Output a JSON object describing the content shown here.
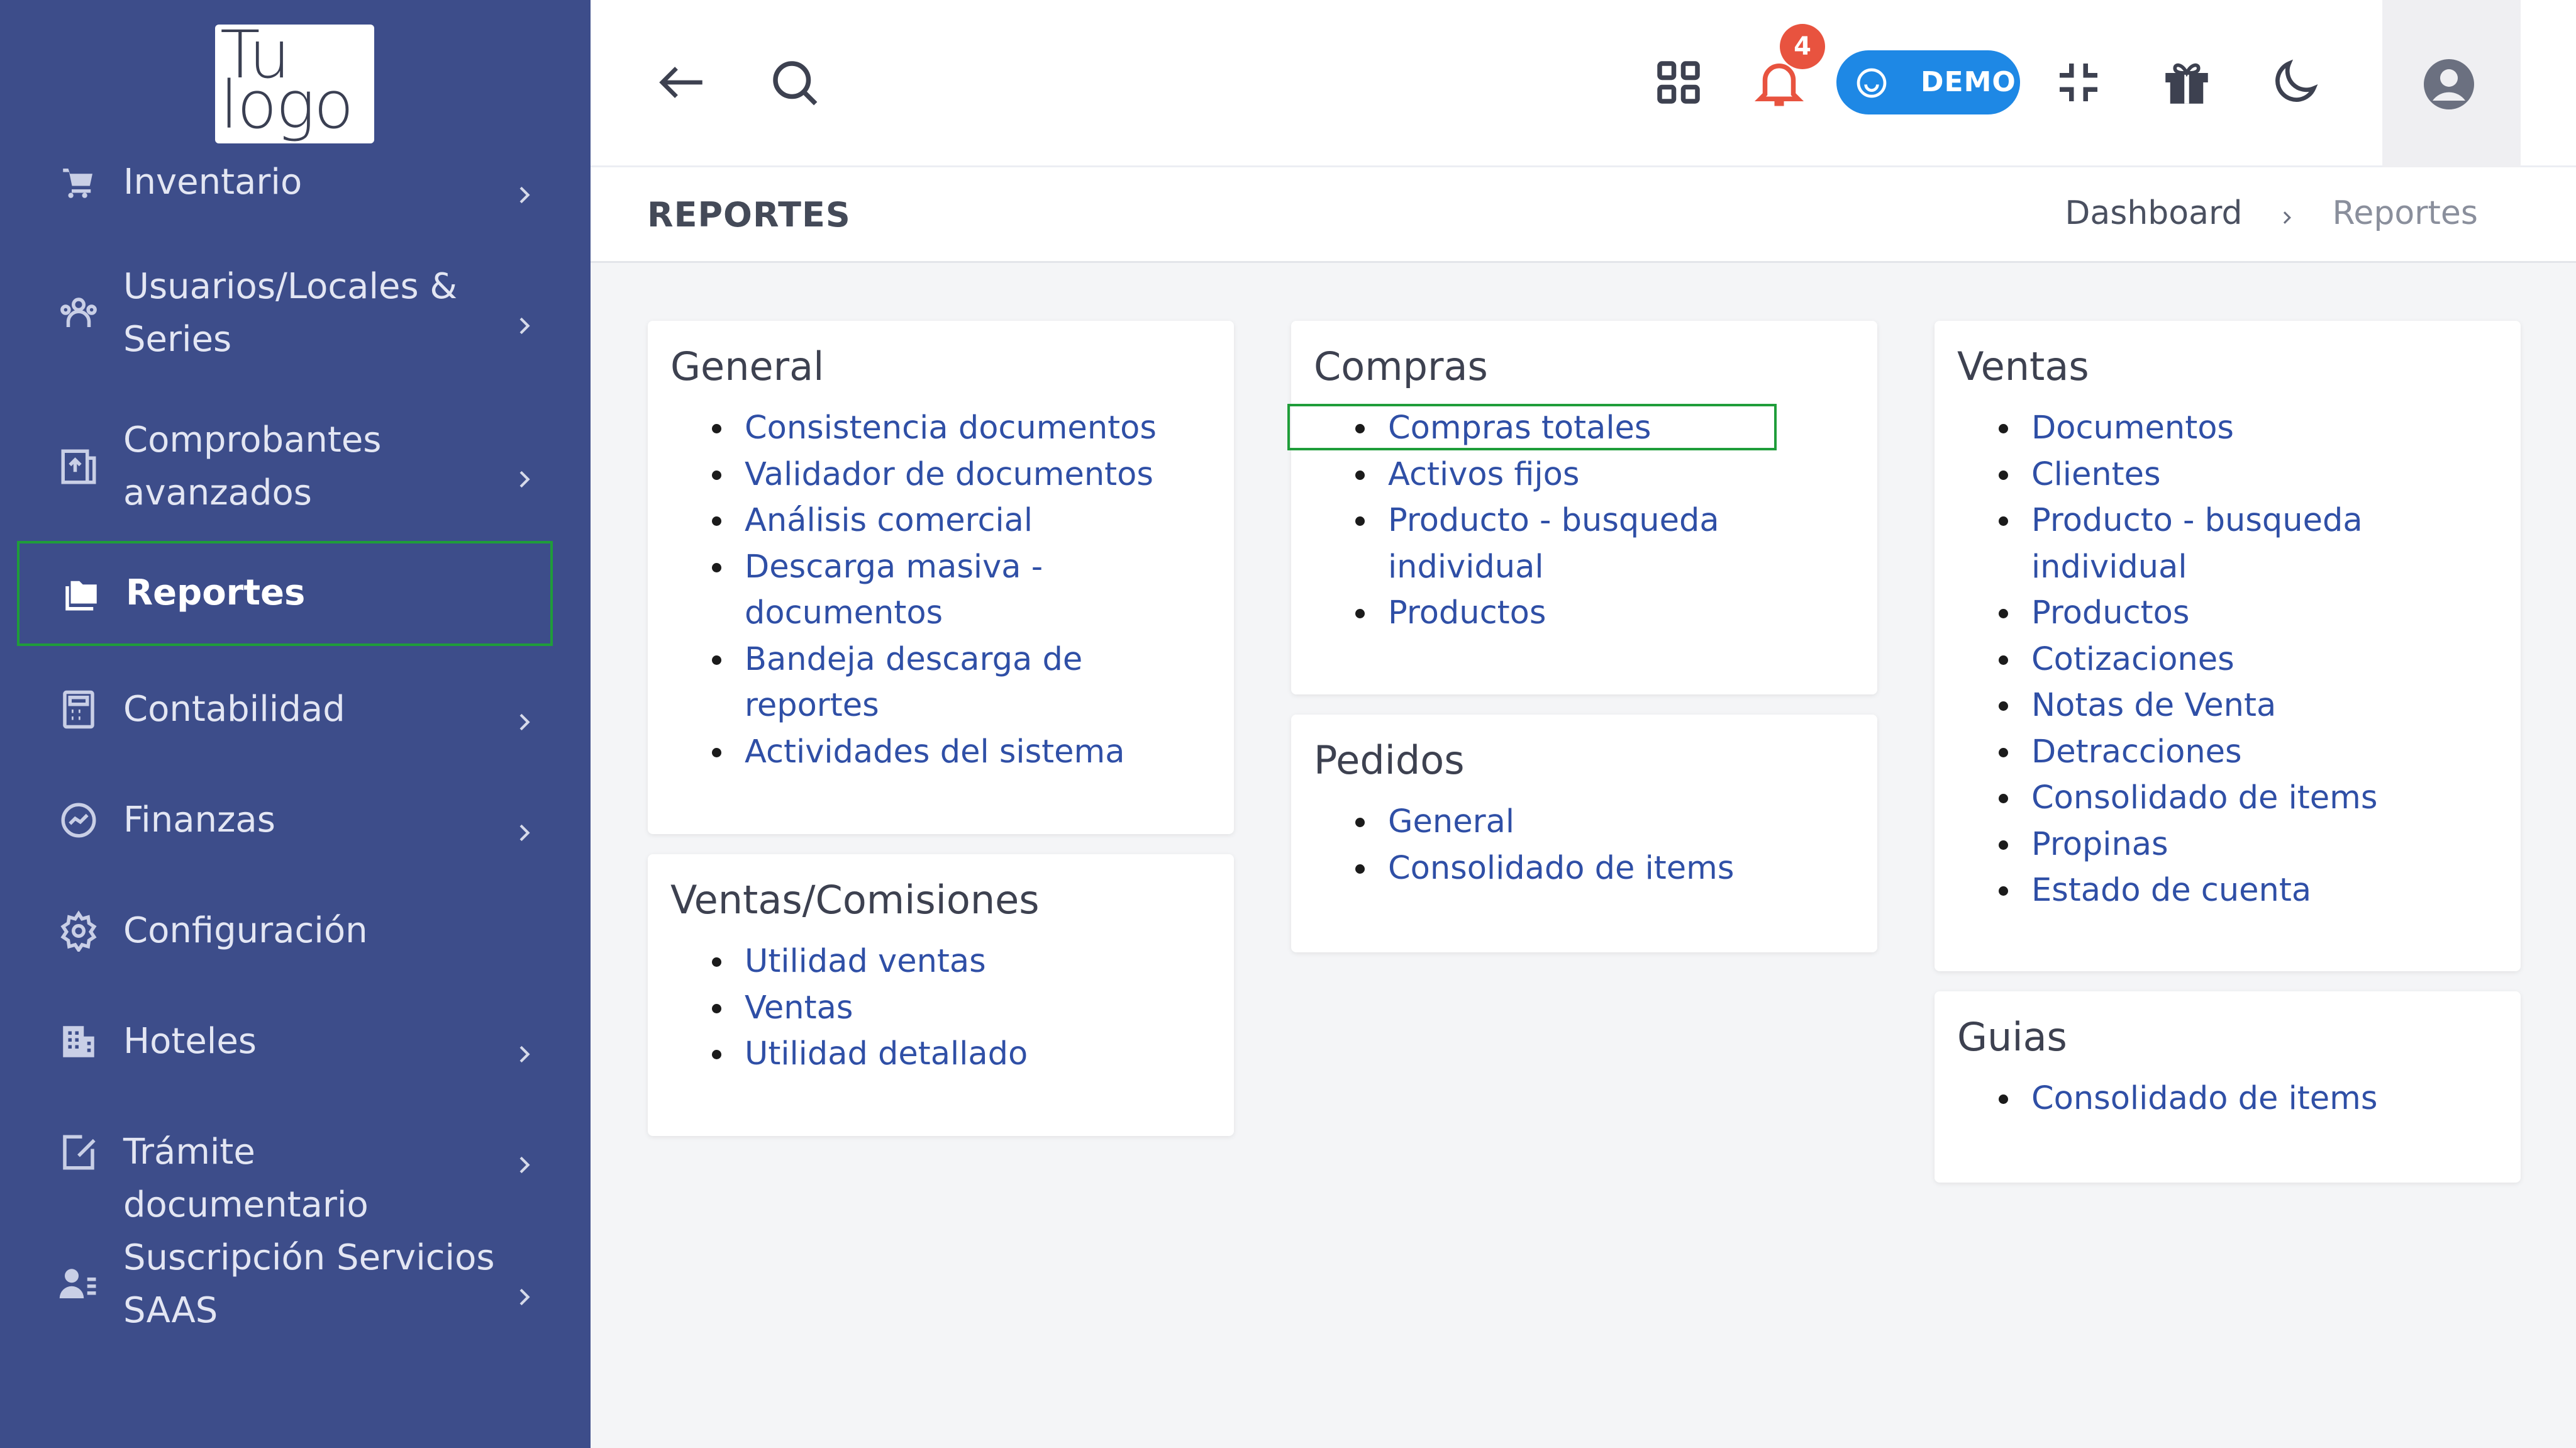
{
  "logo": {
    "line1": "Tu",
    "line2": "logo"
  },
  "sidebar": {
    "items": [
      {
        "label": "Inventario",
        "icon": "cart-icon",
        "has_chevron": true
      },
      {
        "label": "Usuarios/Locales & Series",
        "icon": "users-icon",
        "has_chevron": true
      },
      {
        "label": "Comprobantes avanzados",
        "icon": "document-upload-icon",
        "has_chevron": true
      },
      {
        "label": "Reportes",
        "icon": "folders-icon",
        "has_chevron": false,
        "active": true
      },
      {
        "label": "Contabilidad",
        "icon": "calculator-icon",
        "has_chevron": true
      },
      {
        "label": "Finanzas",
        "icon": "chart-circle-icon",
        "has_chevron": true
      },
      {
        "label": "Configuración",
        "icon": "gear-icon",
        "has_chevron": false
      },
      {
        "label": "Hoteles",
        "icon": "building-icon",
        "has_chevron": true
      },
      {
        "label": "Trámite documentario",
        "icon": "edit-document-icon",
        "has_chevron": true
      },
      {
        "label": "Suscripción Servicios SAAS",
        "icon": "user-list-icon",
        "has_chevron": true
      }
    ]
  },
  "topbar": {
    "notification_count": "4",
    "demo_label": "DEMO"
  },
  "header": {
    "title": "REPORTES",
    "breadcrumb_home": "Dashboard",
    "breadcrumb_current": "Reportes"
  },
  "cards": {
    "general": {
      "title": "General",
      "items": [
        "Consistencia documentos",
        "Validador de documentos",
        "Análisis comercial",
        "Descarga masiva - documentos",
        "Bandeja descarga de reportes",
        "Actividades del sistema"
      ]
    },
    "ventas_comisiones": {
      "title": "Ventas/Comisiones",
      "items": [
        "Utilidad ventas",
        "Ventas",
        "Utilidad detallado"
      ]
    },
    "compras": {
      "title": "Compras",
      "items": [
        "Compras totales",
        "Activos fijos",
        "Producto - busqueda individual",
        "Productos"
      ]
    },
    "pedidos": {
      "title": "Pedidos",
      "items": [
        "General",
        "Consolidado de items"
      ]
    },
    "ventas": {
      "title": "Ventas",
      "items": [
        "Documentos",
        "Clientes",
        "Producto - busqueda individual",
        "Productos",
        "Cotizaciones",
        "Notas de Venta",
        "Detracciones",
        "Consolidado de items",
        "Propinas",
        "Estado de cuenta"
      ]
    },
    "guias": {
      "title": "Guias",
      "items": [
        "Consolidado de items"
      ]
    }
  },
  "colors": {
    "sidebar_bg": "#3d4d8a",
    "link": "#2f4fa6",
    "highlight": "#1f9d3a",
    "badge": "#e8533f",
    "demo": "#1e88e5"
  }
}
